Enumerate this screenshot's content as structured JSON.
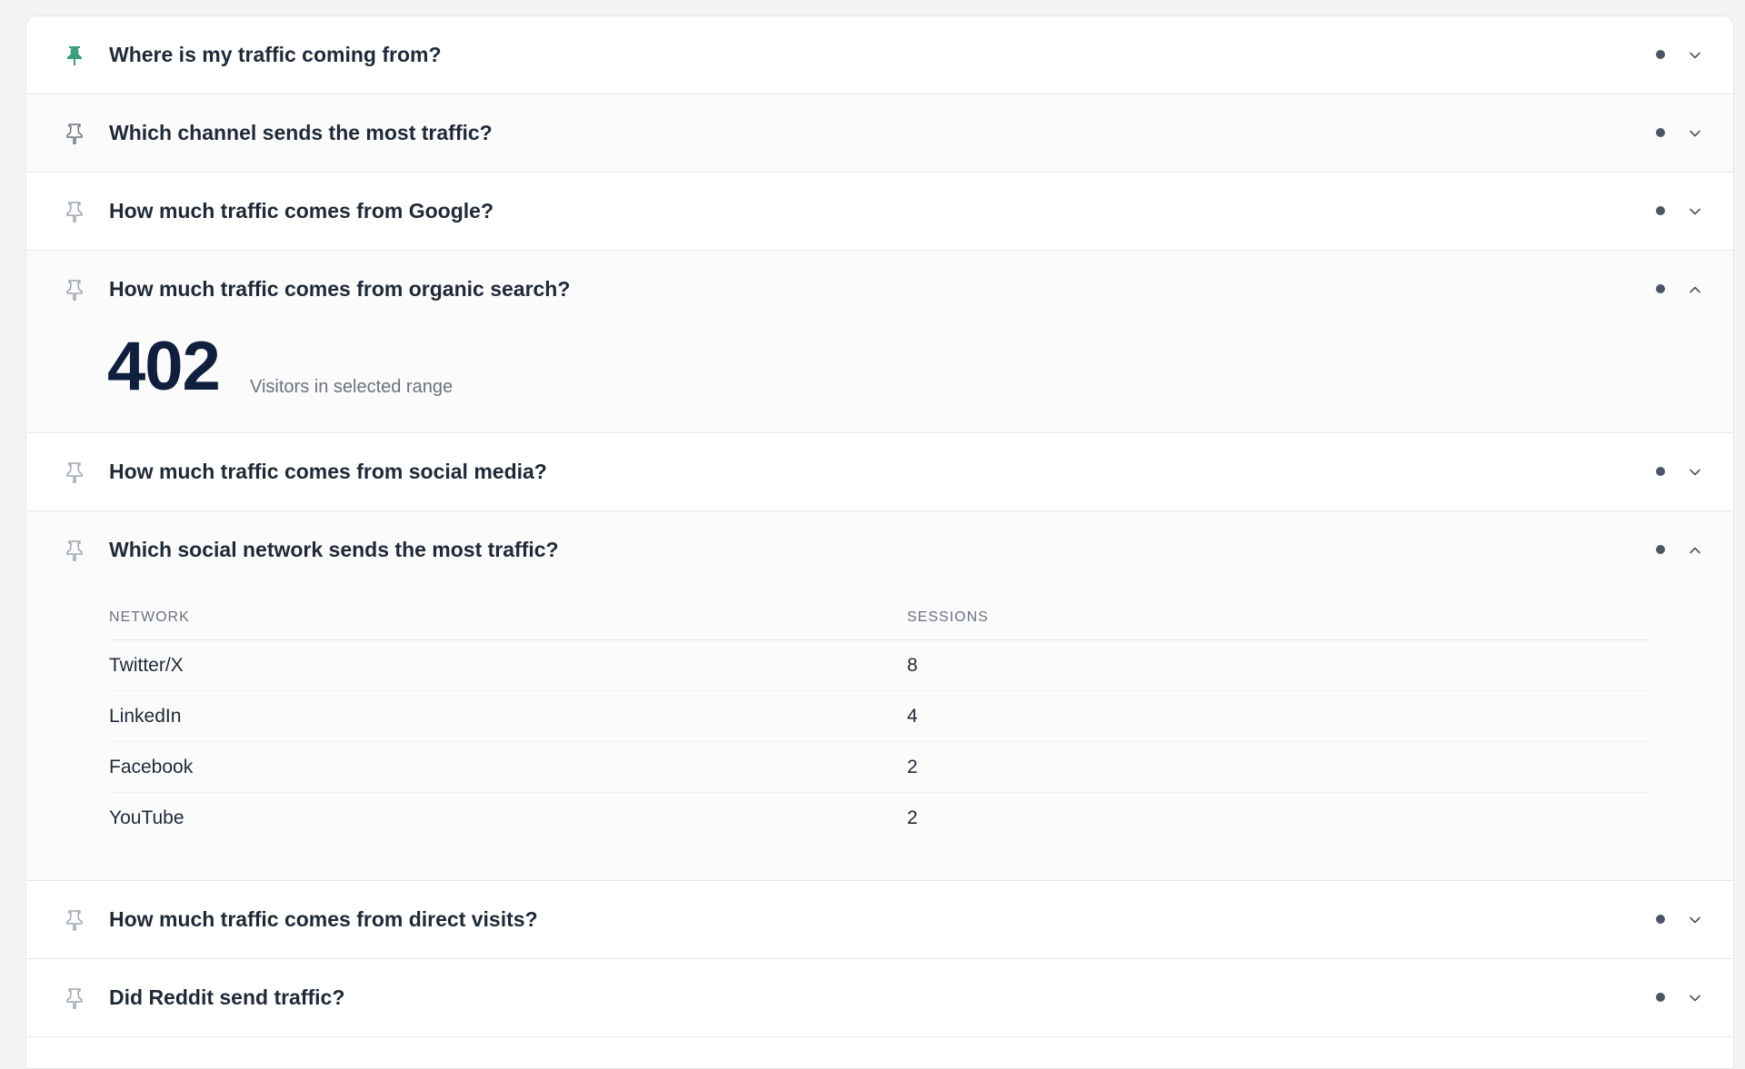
{
  "questions": [
    {
      "title": "Where is my traffic coming from?",
      "pinned": true,
      "expanded": false
    },
    {
      "title": "Which channel sends the most traffic?",
      "pinned": false,
      "expanded": false
    },
    {
      "title": "How much traffic comes from Google?",
      "pinned": false,
      "expanded": false
    },
    {
      "title": "How much traffic comes from organic search?",
      "pinned": false,
      "expanded": true,
      "stat": {
        "value": "402",
        "label": "Visitors in selected range"
      }
    },
    {
      "title": "How much traffic comes from social media?",
      "pinned": false,
      "expanded": false
    },
    {
      "title": "Which social network sends the most traffic?",
      "pinned": false,
      "expanded": true,
      "table": {
        "headers": [
          "NETWORK",
          "SESSIONS"
        ],
        "rows": [
          [
            "Twitter/X",
            "8"
          ],
          [
            "LinkedIn",
            "4"
          ],
          [
            "Facebook",
            "2"
          ],
          [
            "YouTube",
            "2"
          ]
        ]
      }
    },
    {
      "title": "How much traffic comes from direct visits?",
      "pinned": false,
      "expanded": false
    },
    {
      "title": "Did Reddit send traffic?",
      "pinned": false,
      "expanded": false
    }
  ],
  "colors": {
    "pin_active": "#3f9e7c",
    "pin_inactive": "#9ca3af",
    "heading": "#1f2937",
    "stat": "#0f1f3d",
    "muted": "#6b7280"
  },
  "icons": {
    "pin": "pin-icon",
    "status": "status-dot-icon",
    "collapsed": "chevron-down-icon",
    "expanded": "chevron-up-icon"
  }
}
